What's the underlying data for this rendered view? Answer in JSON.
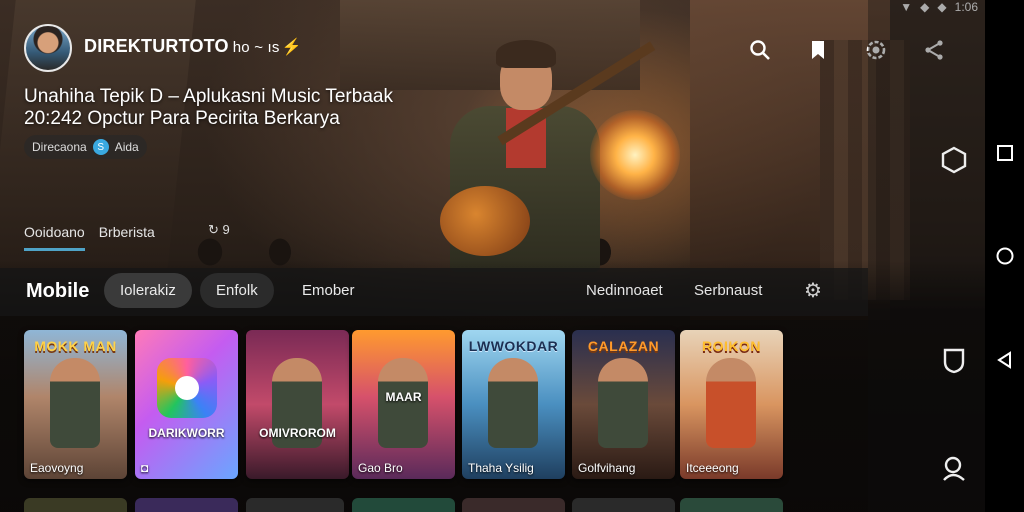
{
  "status": {
    "signal_icons": [
      "wifi-icon",
      "signal-icon",
      "signal-icon-2"
    ],
    "time": "1:06"
  },
  "header": {
    "brand": "DIREKTURTOTO",
    "brand_suffix": "ho ~ ıs",
    "bolt": "⚡",
    "icons": [
      "search-icon",
      "badge-icon",
      "gear-icon",
      "share-icon"
    ]
  },
  "hero": {
    "headline_line1": "Unahiha Tepik D – Aplukasni Music Terbaak",
    "headline_line2": "20:242 Opctur Para Pecirita Berkarya",
    "meta_left": "Direcaona",
    "meta_icon_text": "S",
    "meta_right": "Aida"
  },
  "subtabs": {
    "active": "Ooidoano",
    "second": "Brberista",
    "badge": "↻ 9"
  },
  "categories": {
    "title": "Mobile",
    "chips": [
      "Iolerakiz",
      "Enfolk",
      "Emober"
    ],
    "right_links": [
      "Nedinnoaet",
      "Serbnaust"
    ],
    "settings_icon": "gear-icon"
  },
  "cards": [
    {
      "art_title": "MOKK MAN",
      "caption": "Eaovoyng"
    },
    {
      "art_title": "",
      "bottom_title": "DARIKWORR",
      "caption": "◘"
    },
    {
      "art_title": "",
      "bottom_title": "OMIVROROM",
      "caption": ""
    },
    {
      "art_title": "",
      "bottom_title": "MAAR",
      "caption": "Gao Bro"
    },
    {
      "art_title": "LWWOKDAR",
      "caption": "Thaha Ysilig"
    },
    {
      "art_title": "CALAZAN",
      "caption": "Golfvihang"
    },
    {
      "art_title": "ROIKON",
      "caption": "Itceeeong"
    }
  ],
  "side_icons": [
    "hexagon-icon",
    "shield-icon",
    "profile-icon"
  ],
  "nav": [
    "square-icon",
    "circle-icon",
    "triangle-back-icon"
  ]
}
